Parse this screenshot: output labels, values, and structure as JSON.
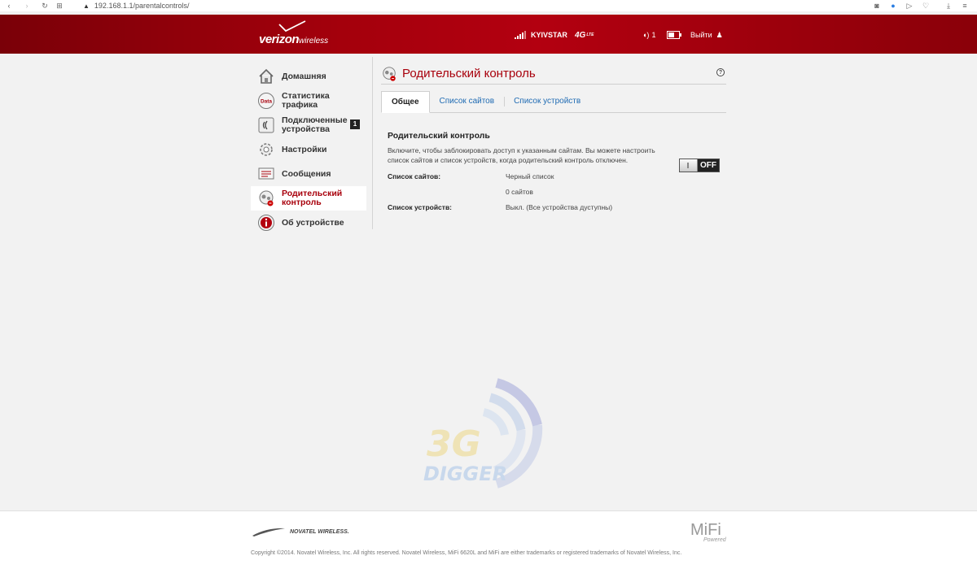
{
  "browser": {
    "url": "192.168.1.1/parentalcontrols/"
  },
  "header": {
    "logo_brand": "verizon",
    "logo_sub": "wireless",
    "carrier": "KYIVSTAR",
    "network": "4G",
    "network_suffix": "LTE",
    "connected_count": "1",
    "logout_label": "Выйти",
    "signal_bars": 5,
    "signal_active": 4,
    "battery_level": 0.6
  },
  "sidebar": {
    "items": [
      {
        "label": "Домашняя",
        "icon": "home-icon"
      },
      {
        "label": "Статистика трафика",
        "icon": "data-usage-icon"
      },
      {
        "label": "Подключенные устройства",
        "icon": "connected-devices-icon",
        "badge": "1"
      },
      {
        "label": "Настройки",
        "icon": "gear-icon"
      },
      {
        "label": "Сообщения",
        "icon": "messages-icon"
      },
      {
        "label": "Родительский контроль",
        "icon": "parental-controls-icon",
        "active": true
      },
      {
        "label": "Об устройстве",
        "icon": "info-icon"
      }
    ]
  },
  "main": {
    "title": "Родительский контроль",
    "help_glyph": "?",
    "tabs": [
      {
        "label": "Общее",
        "active": true
      },
      {
        "label": "Список сайтов"
      },
      {
        "label": "Список устройств"
      }
    ],
    "section": {
      "title": "Родительский контроль",
      "description": "Включите, чтобы заблокировать доступ к указанным сайтам. Вы можете настроить список сайтов и список устройств, когда родительский контроль отключен.",
      "toggle_state": "OFF",
      "rows": [
        {
          "key": "Список сайтов:",
          "value": "Черный список"
        },
        {
          "key": "",
          "value": "0 сайтов"
        },
        {
          "key": "Список устройств:",
          "value": "Выкл. (Все устройства дуступны)"
        }
      ]
    }
  },
  "watermark": {
    "line1": "3G",
    "line2": "DIGGER"
  },
  "footer": {
    "partner": "NOVATEL WIRELESS.",
    "mifi": "MiFi",
    "mifi_sub": "Powered",
    "copyright": "Copyright ©2014. Novatel Wireless, Inc. All rights reserved. Novatel Wireless, MiFi 6620L and MiFi are either trademarks or registered trademarks of Novatel Wireless, Inc."
  },
  "colors": {
    "brand_red": "#a8000c",
    "link_blue": "#1f6bb3"
  }
}
